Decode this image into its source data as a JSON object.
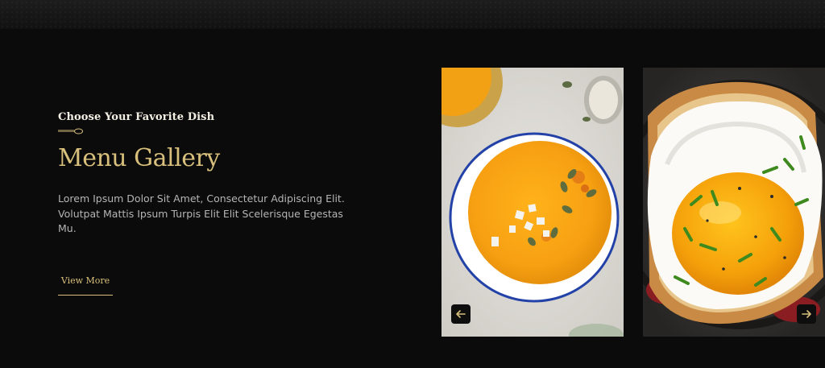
{
  "section": {
    "subtitle": "Choose Your Favorite Dish",
    "title": "Menu Gallery",
    "description": "Lorem Ipsum Dolor Sit Amet, Consectetur Adipiscing Elit. Volutpat Mattis Ipsum Turpis Elit Elit Scelerisque Egestas Mu.",
    "button_label": "View More"
  },
  "gallery": {
    "images": [
      "pumpkin-soup-bowl",
      "fried-egg-toast"
    ],
    "prev_icon": "arrow-left-icon",
    "next_icon": "arrow-right-icon"
  },
  "colors": {
    "background": "#0b0b0b",
    "accent_gold": "#d8c07c",
    "heading_white": "#f3efe4",
    "body_text": "#b5b5b5"
  }
}
